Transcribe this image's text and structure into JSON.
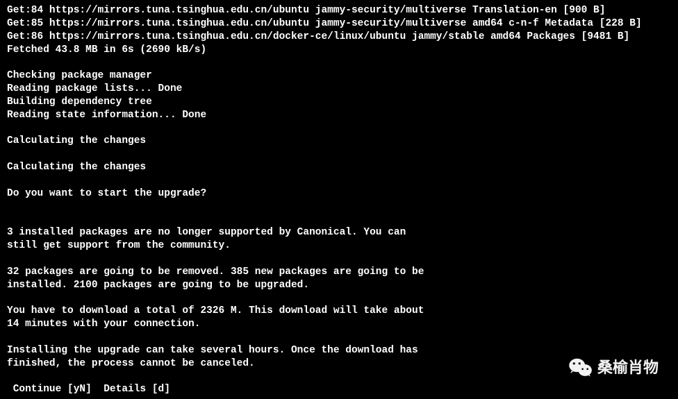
{
  "terminal": {
    "lines": [
      "Get:84 https://mirrors.tuna.tsinghua.edu.cn/ubuntu jammy-security/multiverse Translation-en [900 B]",
      "Get:85 https://mirrors.tuna.tsinghua.edu.cn/ubuntu jammy-security/multiverse amd64 c-n-f Metadata [228 B]",
      "Get:86 https://mirrors.tuna.tsinghua.edu.cn/docker-ce/linux/ubuntu jammy/stable amd64 Packages [9481 B]",
      "Fetched 43.8 MB in 6s (2690 kB/s)",
      "",
      "Checking package manager",
      "Reading package lists... Done",
      "Building dependency tree",
      "Reading state information... Done",
      "",
      "Calculating the changes",
      "",
      "Calculating the changes",
      "",
      "Do you want to start the upgrade?",
      "",
      "",
      "3 installed packages are no longer supported by Canonical. You can",
      "still get support from the community.",
      "",
      "32 packages are going to be removed. 385 new packages are going to be",
      "installed. 2100 packages are going to be upgraded.",
      "",
      "You have to download a total of 2326 M. This download will take about",
      "14 minutes with your connection.",
      "",
      "Installing the upgrade can take several hours. Once the download has",
      "finished, the process cannot be canceled.",
      "",
      " Continue [yN]  Details [d]"
    ]
  },
  "watermark": {
    "text": "桑榆肖物"
  }
}
